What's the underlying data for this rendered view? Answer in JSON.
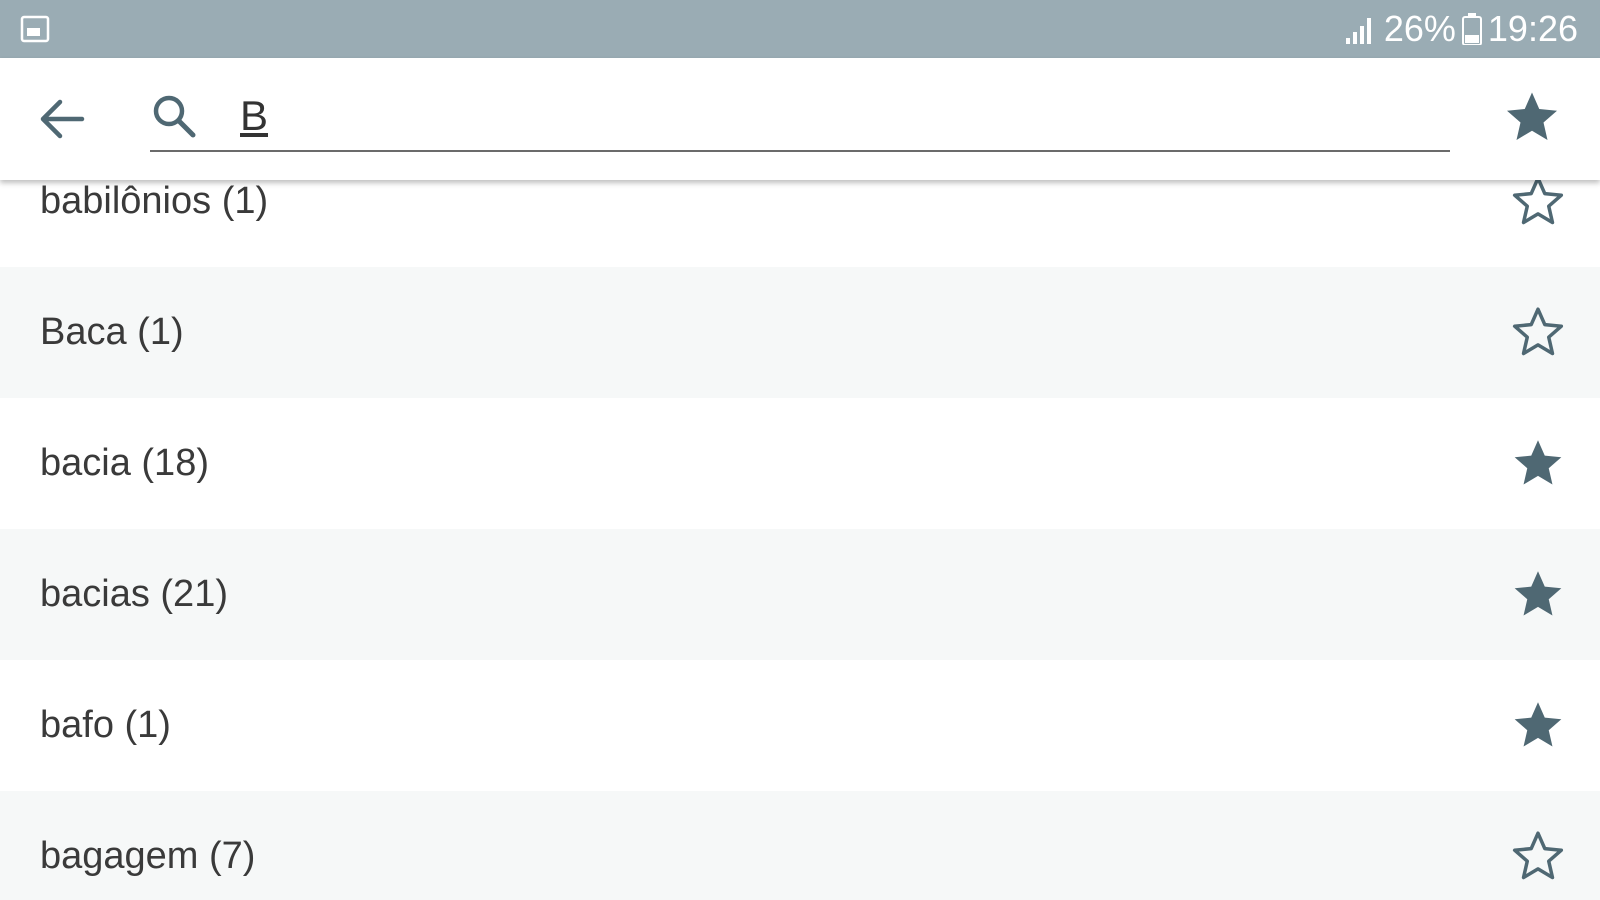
{
  "status_bar": {
    "left_icon": "image-notification-icon",
    "signal_icon": "signal-icon",
    "battery_percent": "26%",
    "battery_icon": "battery-icon",
    "time": "19:26"
  },
  "toolbar": {
    "back_icon": "arrow-back-icon",
    "search_icon": "search-icon",
    "search_value": "B",
    "favorites_icon": "star-filled-icon"
  },
  "colors": {
    "status_bar_bg": "#9aacb4",
    "accent": "#4f6873",
    "row_alt_bg": "#f6f8f8",
    "text": "#3a3a3a"
  },
  "results": [
    {
      "label": "babilônios (1)",
      "favorite": false
    },
    {
      "label": "Baca (1)",
      "favorite": false
    },
    {
      "label": "bacia (18)",
      "favorite": true
    },
    {
      "label": "bacias (21)",
      "favorite": true
    },
    {
      "label": "bafo (1)",
      "favorite": true
    },
    {
      "label": "bagagem (7)",
      "favorite": false
    }
  ]
}
